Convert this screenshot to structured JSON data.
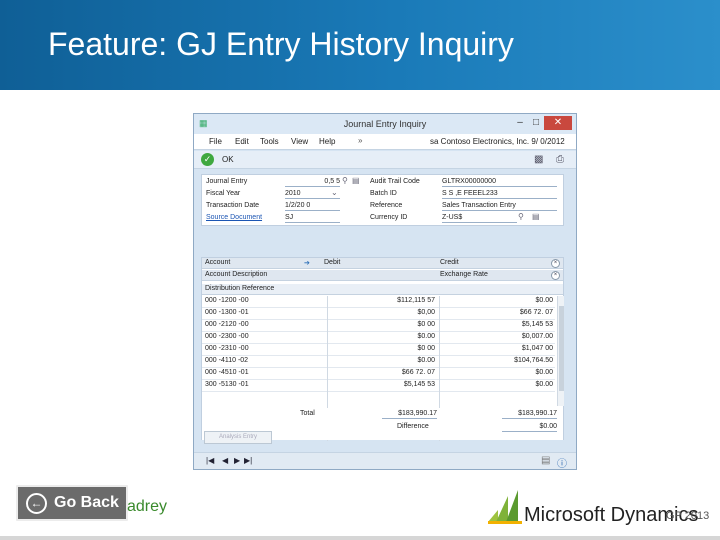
{
  "slide": {
    "title": "Feature: GJ Entry History Inquiry"
  },
  "window": {
    "title": "Journal Entry Inquiry",
    "min": "–",
    "max": "□",
    "close": "✕",
    "menu": [
      "File",
      "Edit",
      "Tools",
      "View",
      "Help"
    ],
    "company_bar": "sa  Contoso Electronics, Inc.  9/ 0/2012",
    "toolbar_ok": "OK"
  },
  "header": {
    "journal_entry_label": "Journal Entry",
    "journal_entry_value": "0,5 5",
    "fiscal_year_label": "Fiscal Year",
    "fiscal_year_value": "2010",
    "transaction_date_label": "Transaction Date",
    "transaction_date_value": "1/2/20 0",
    "source_document_label": "Source Document",
    "source_document_value": "SJ",
    "audit_trail_label": "Audit Trail Code",
    "audit_trail_value": "GLTRX00000000",
    "batch_id_label": "Batch ID",
    "batch_id_value": "S S ,E FEEEL233",
    "reference_label": "Reference",
    "reference_value": "Sales Transaction Entry",
    "currency_label": "Currency ID",
    "currency_value": "Z-US$"
  },
  "grid": {
    "col_account": "Account",
    "col_debit": "Debit",
    "col_credit": "Credit",
    "col_account_desc": "Account Description",
    "col_exchange_rate": "Exchange Rate",
    "col_dist_ref": "Distribution Reference",
    "rows": [
      {
        "account": "000 -1200 -00",
        "debit": "$112,115 57",
        "credit": "$0.00"
      },
      {
        "account": "000 -1300 -01",
        "debit": "$0,00",
        "credit": "$66 72. 07"
      },
      {
        "account": "000 -2120 -00",
        "debit": "$0 00",
        "credit": "$5,145 53"
      },
      {
        "account": "000 -2300 -00",
        "debit": "$0.00",
        "credit": "$0,007.00"
      },
      {
        "account": "000 -2310 -00",
        "debit": "$0 00",
        "credit": "$1,047 00"
      },
      {
        "account": "000 -4110 -02",
        "debit": "$0.00",
        "credit": "$104,764.50"
      },
      {
        "account": "000 -4510 -01",
        "debit": "$66 72. 07",
        "credit": "$0.00"
      },
      {
        "account": "300 -5130 -01",
        "debit": "$5,145 53",
        "credit": "$0.00"
      }
    ],
    "total_label": "Total",
    "total_debit": "$183,990.17",
    "total_credit": "$183,990.17",
    "difference_label": "Difference",
    "difference_value": "$0.00",
    "disabled_button": "Analysis Entry"
  },
  "footer": {
    "go_back": "Go Back",
    "brand_fragment": "adrey",
    "ms_text": "Microsoft Dynamics",
    "gp": "GP 2013"
  }
}
